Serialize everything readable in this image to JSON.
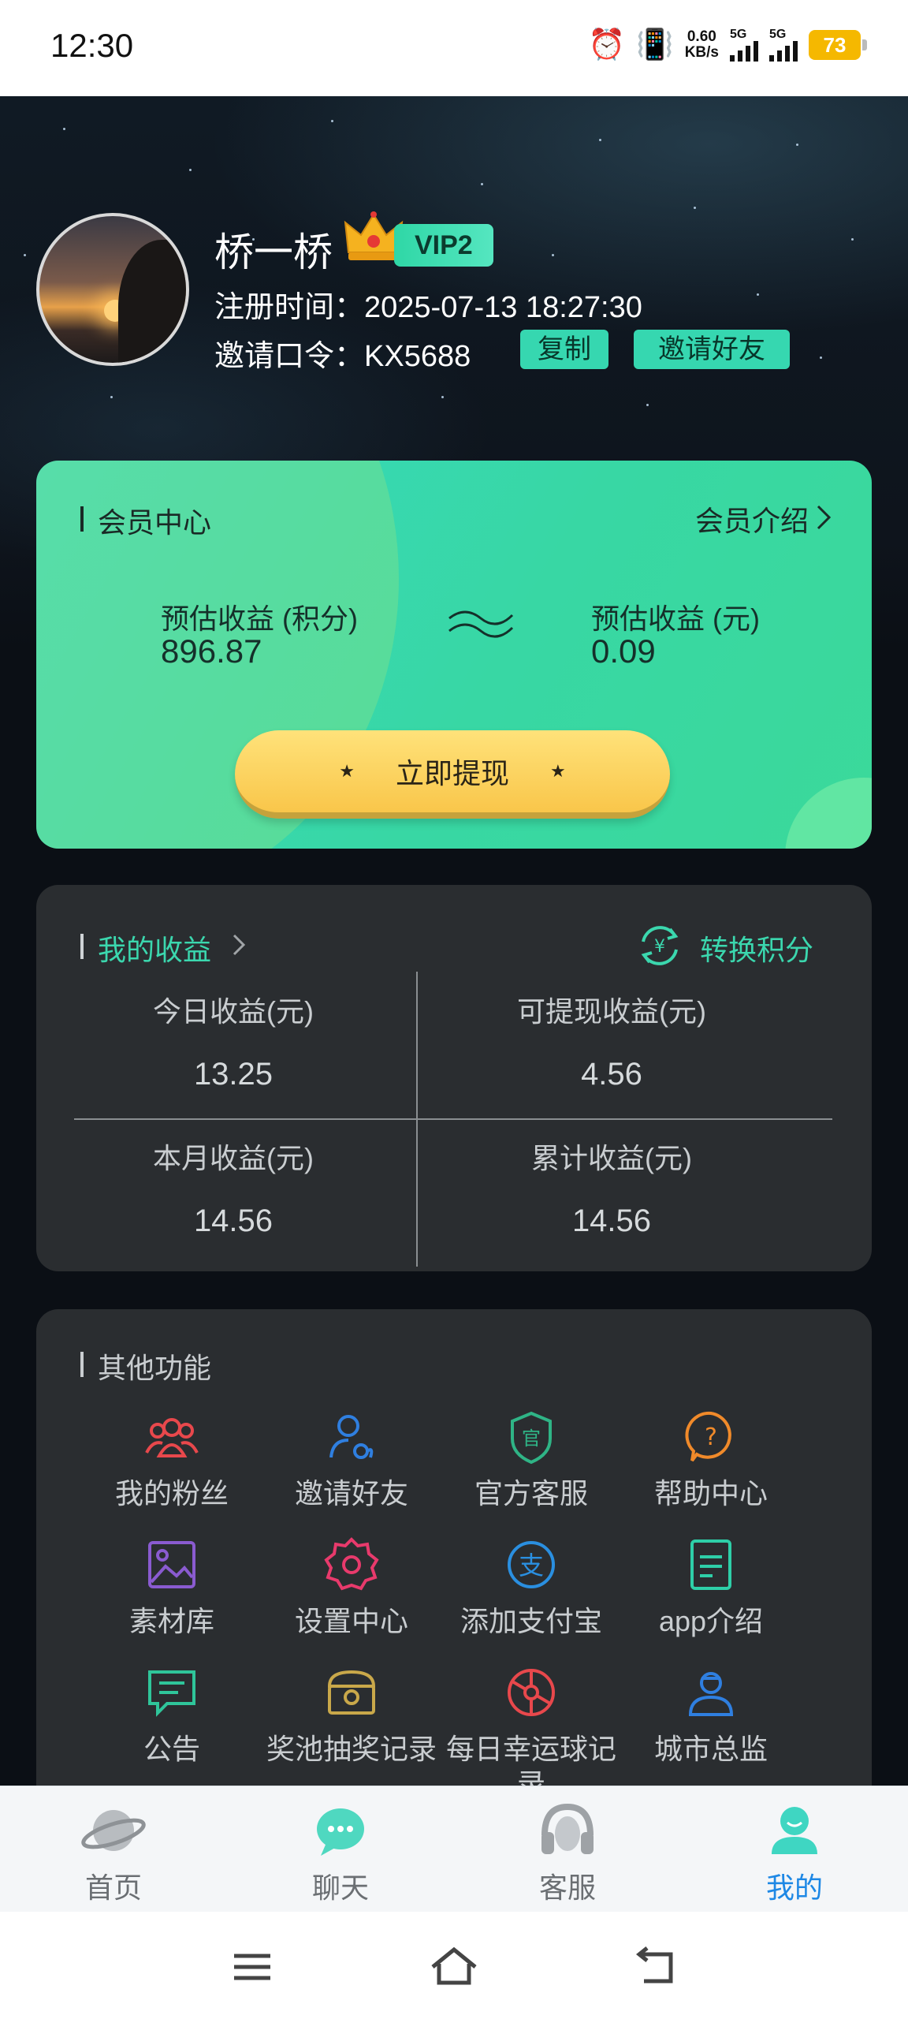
{
  "status_bar": {
    "time": "12:30",
    "net_speed_value": "0.60",
    "net_speed_unit": "KB/s",
    "signal1_label": "5G",
    "signal2_label": "5G",
    "battery": "73"
  },
  "profile": {
    "username": "桥一桥",
    "vip_label": "VIP2",
    "register_time": "注册时间：2025-07-13 18:27:30",
    "invite_code": "邀请口令：KX5688",
    "copy_label": "复制",
    "invite_friend_label": "邀请好友"
  },
  "member_card": {
    "title": "会员中心",
    "intro_label": "会员介绍",
    "points_label": "预估收益 (积分)",
    "points_value": "896.87",
    "yuan_label": "预估收益 (元)",
    "yuan_value": "0.09",
    "withdraw_label": "立即提现",
    "star": "★"
  },
  "earnings": {
    "title": "我的收益",
    "convert_label": "转换积分",
    "cells": [
      {
        "label": "今日收益(元)",
        "value": "13.25"
      },
      {
        "label": "可提现收益(元)",
        "value": "4.56"
      },
      {
        "label": "本月收益(元)",
        "value": "14.56"
      },
      {
        "label": "累计收益(元)",
        "value": "14.56"
      }
    ]
  },
  "functions": {
    "title": "其他功能",
    "items": [
      {
        "label": "我的粉丝",
        "icon": "fans-icon",
        "color": "#e8484c"
      },
      {
        "label": "邀请好友",
        "icon": "invite-user-icon",
        "color": "#2f7fe0"
      },
      {
        "label": "官方客服",
        "icon": "official-service-icon",
        "color": "#2fb486"
      },
      {
        "label": "帮助中心",
        "icon": "help-icon",
        "color": "#f08a2a"
      },
      {
        "label": "素材库",
        "icon": "image-library-icon",
        "color": "#8a5bd0"
      },
      {
        "label": "设置中心",
        "icon": "settings-icon",
        "color": "#e83a6c"
      },
      {
        "label": "添加支付宝",
        "icon": "alipay-icon",
        "color": "#2a8fe0"
      },
      {
        "label": "app介绍",
        "icon": "app-intro-icon",
        "color": "#2ecfa8"
      },
      {
        "label": "公告",
        "icon": "announcement-icon",
        "color": "#2fc59a"
      },
      {
        "label": "奖池抽奖记录",
        "icon": "prize-pool-icon",
        "color": "#c9a84a"
      },
      {
        "label": "每日幸运球记录",
        "icon": "lucky-ball-icon",
        "color": "#e8484c"
      },
      {
        "label": "城市总监",
        "icon": "city-director-icon",
        "color": "#2f7fe0"
      }
    ]
  },
  "tab_bar": {
    "tabs": [
      {
        "label": "首页",
        "icon": "planet-icon"
      },
      {
        "label": "聊天",
        "icon": "chat-icon"
      },
      {
        "label": "客服",
        "icon": "headset-icon"
      },
      {
        "label": "我的",
        "icon": "profile-icon",
        "active": true
      }
    ],
    "active_color": "#1e88e5"
  }
}
